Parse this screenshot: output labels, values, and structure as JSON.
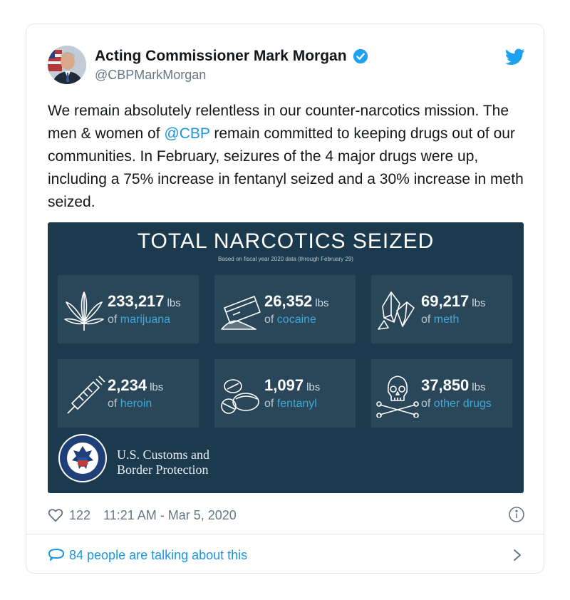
{
  "tweet": {
    "author": {
      "display_name": "Acting Commissioner Mark Morgan",
      "handle": "@CBPMarkMorgan",
      "verified": true
    },
    "text": {
      "part1": "We remain absolutely relentless in our counter-narcotics mission. The men & women of ",
      "mention": "@CBP",
      "part2": " remain committed to keeping drugs out of our communities. In February, seizures of the 4 major drugs were up, including a 75% increase in fentanyl seized and a 30% increase in meth seized."
    },
    "infographic": {
      "title": "TOTAL NARCOTICS SEIZED",
      "subtitle": "Based on fiscal year 2020 data (through February 29)",
      "stats": [
        {
          "amount": "233,217",
          "unit": "lbs",
          "prefix": "of",
          "drug": "marijuana",
          "icon": "cannabis-leaf-icon"
        },
        {
          "amount": "26,352",
          "unit": "lbs",
          "prefix": "of",
          "drug": "cocaine",
          "icon": "card-powder-icon"
        },
        {
          "amount": "69,217",
          "unit": "lbs",
          "prefix": "of",
          "drug": "meth",
          "icon": "crystals-icon"
        },
        {
          "amount": "2,234",
          "unit": "lbs",
          "prefix": "of",
          "drug": "heroin",
          "icon": "syringe-icon"
        },
        {
          "amount": "1,097",
          "unit": "lbs",
          "prefix": "of",
          "drug": "fentanyl",
          "icon": "pills-icon"
        },
        {
          "amount": "37,850",
          "unit": "lbs",
          "prefix": "of",
          "drug": "other drugs",
          "icon": "skull-crossbones-icon"
        }
      ],
      "agency_line1": "U.S. Customs and",
      "agency_line2": "Border Protection",
      "seal_icon": "dhs-seal-icon"
    },
    "likes": "122",
    "timestamp": "11:21 AM - Mar 5, 2020",
    "talking": "84 people are talking about this"
  },
  "colors": {
    "twitter_blue": "#1da1f2",
    "link_blue": "#1b95e0",
    "infographic_bg": "#1c3a4d",
    "tile_bg": "#2a475a",
    "drug_accent": "#3fa8d6",
    "muted_text": "#657786"
  }
}
